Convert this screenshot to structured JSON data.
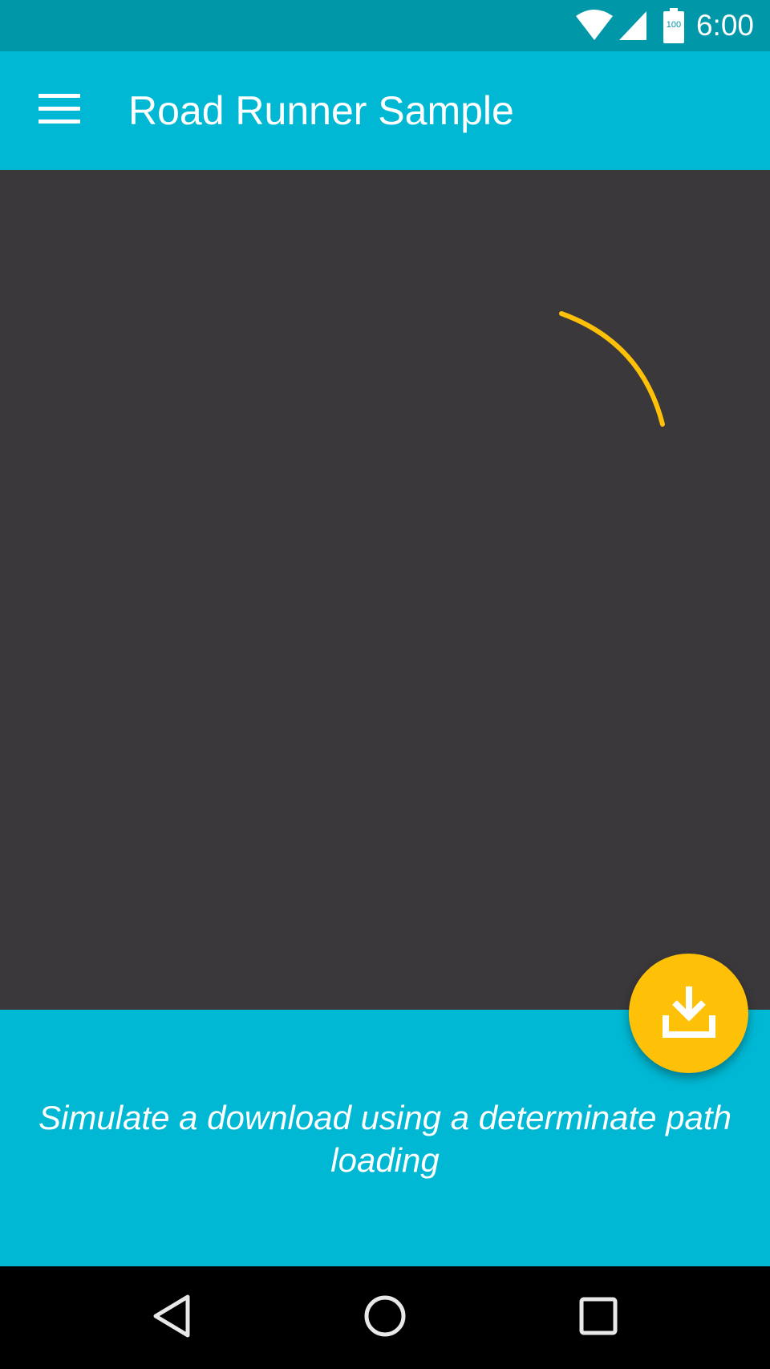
{
  "status_bar": {
    "time": "6:00",
    "battery_level": "100",
    "icons": [
      "wifi-icon",
      "cell-signal-icon",
      "battery-icon"
    ]
  },
  "app_bar": {
    "title": "Road Runner Sample",
    "menu_icon": "hamburger-menu-icon"
  },
  "loader": {
    "type": "determinate-path-loading",
    "color": "#ffc107"
  },
  "caption": "Simulate a download using a determinate path loading",
  "fab": {
    "icon": "download-icon",
    "color": "#ffc107"
  },
  "nav_bar": {
    "icons": [
      "back-icon",
      "home-icon",
      "recents-icon"
    ]
  },
  "colors": {
    "primary": "#00b8d4",
    "primary_dark": "#0097a8",
    "accent": "#ffc107",
    "background": "#3a383b"
  }
}
